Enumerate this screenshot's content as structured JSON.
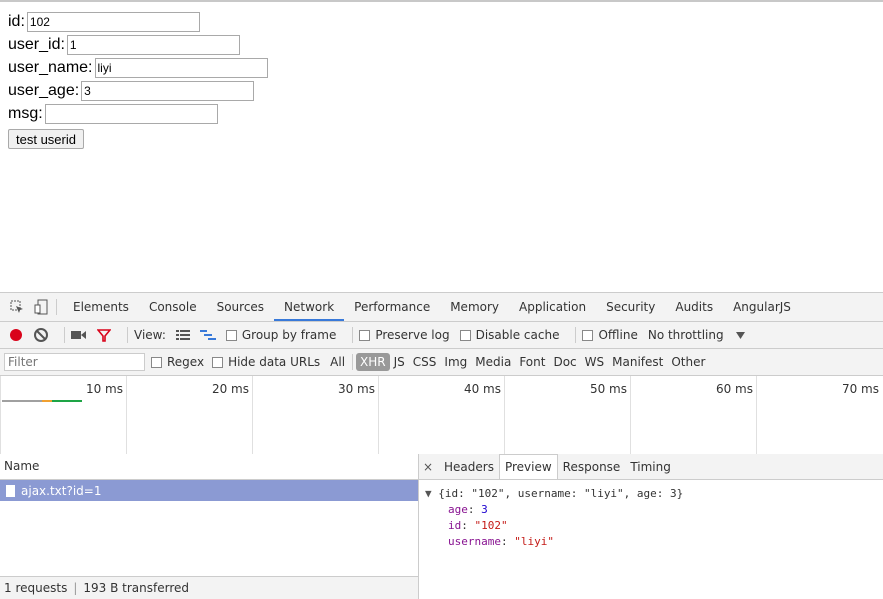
{
  "form": {
    "fields": [
      {
        "label": "id:",
        "value": "102"
      },
      {
        "label": "user_id:",
        "value": "1"
      },
      {
        "label": "user_name:",
        "value": "liyi"
      },
      {
        "label": "user_age:",
        "value": "3"
      },
      {
        "label": "msg:",
        "value": ""
      }
    ],
    "button_label": "test userid"
  },
  "devtools": {
    "tabs": [
      "Elements",
      "Console",
      "Sources",
      "Network",
      "Performance",
      "Memory",
      "Application",
      "Security",
      "Audits",
      "AngularJS"
    ],
    "active_tab": "Network",
    "toolbar": {
      "view_label": "View:",
      "group_by_frame": "Group by frame",
      "preserve_log": "Preserve log",
      "disable_cache": "Disable cache",
      "offline": "Offline",
      "throttling": "No throttling"
    },
    "filter": {
      "placeholder": "Filter",
      "regex": "Regex",
      "hide_data_urls": "Hide data URLs",
      "types": [
        "All",
        "XHR",
        "JS",
        "CSS",
        "Img",
        "Media",
        "Font",
        "Doc",
        "WS",
        "Manifest",
        "Other"
      ],
      "active_type": "XHR"
    },
    "timeline_ticks": [
      "10 ms",
      "20 ms",
      "30 ms",
      "40 ms",
      "50 ms",
      "60 ms",
      "70 ms"
    ],
    "requests": {
      "header": "Name",
      "items": [
        "ajax.txt?id=1"
      ],
      "status_count": "1 requests",
      "status_transferred": "193 B transferred"
    },
    "detail": {
      "close": "×",
      "tabs": [
        "Headers",
        "Preview",
        "Response",
        "Timing"
      ],
      "active_tab": "Preview",
      "summary": "{id: \"102\", username: \"liyi\", age: 3}",
      "props": [
        {
          "key": "age",
          "value": "3",
          "kind": "num"
        },
        {
          "key": "id",
          "value": "\"102\"",
          "kind": "str"
        },
        {
          "key": "username",
          "value": "\"liyi\"",
          "kind": "str"
        }
      ]
    }
  }
}
